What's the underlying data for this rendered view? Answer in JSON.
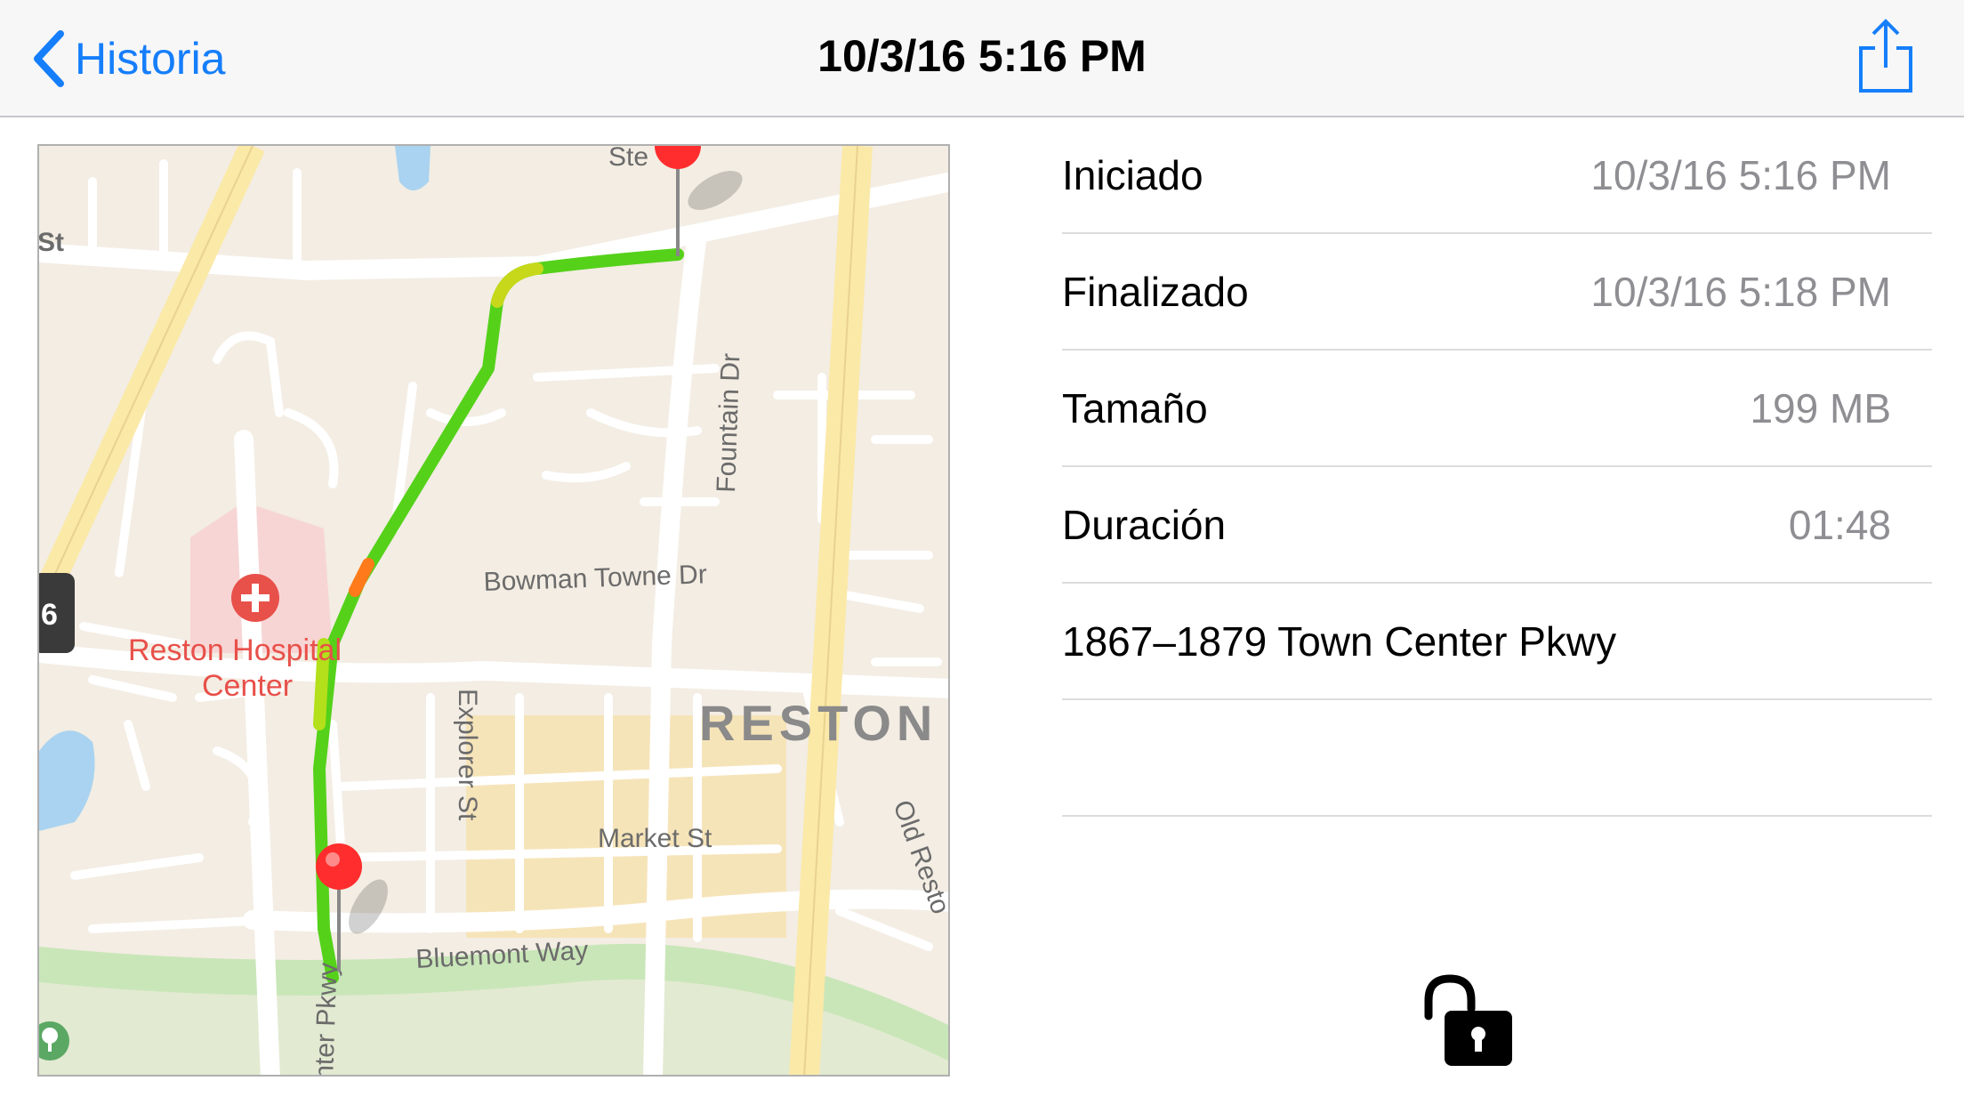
{
  "navbar": {
    "back_label": "Historia",
    "title": "10/3/16 5:16 PM",
    "share_icon": "share-icon"
  },
  "map": {
    "labels": {
      "street_top": "Ste",
      "street_left": "St",
      "fountain": "Fountain Dr",
      "bowman": "Bowman Towne Dr",
      "hospital_line1": "Reston Hospital",
      "hospital_line2": "Center",
      "explorer": "Explorer St",
      "reston": "RESTON",
      "market": "Market St",
      "bluemont": "Bluemont Way",
      "old_reston": "Old Resto",
      "parkway": "nter Pkwy",
      "route": "6"
    },
    "colors": {
      "land": "#f3ede3",
      "road": "#ffffff",
      "highway": "#fbe9a8",
      "water": "#a9d3f0",
      "park": "#c9e6b8",
      "route_green": "#55d11a",
      "pin": "#ff2d2d"
    }
  },
  "details": {
    "rows": [
      {
        "label": "Iniciado",
        "value": "10/3/16 5:16 PM"
      },
      {
        "label": "Finalizado",
        "value": "10/3/16 5:18 PM"
      },
      {
        "label": "Tamaño",
        "value": "199 MB"
      },
      {
        "label": "Duración",
        "value": "01:48"
      },
      {
        "label": "1867–1879 Town Center Pkwy",
        "value": ""
      },
      {
        "label": "",
        "value": ""
      }
    ]
  },
  "lock_icon": "unlocked-padlock-icon"
}
